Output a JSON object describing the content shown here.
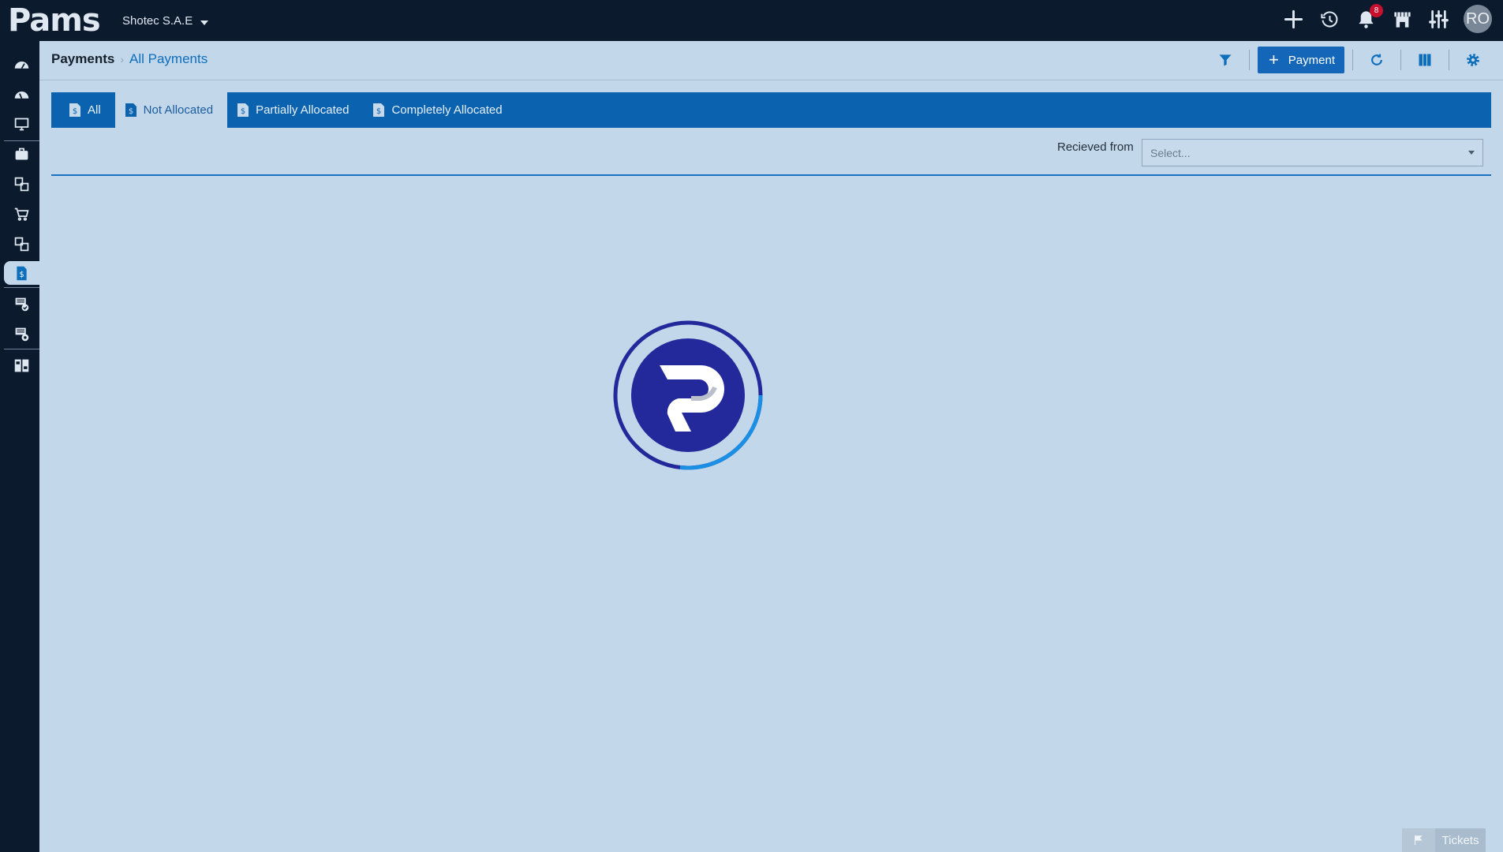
{
  "app": {
    "logo_text": "Pams",
    "company": "Shotec S.A.E"
  },
  "topbar": {
    "icons": [
      "plus-icon",
      "history-icon",
      "bell-icon",
      "store-icon",
      "sliders-icon"
    ],
    "notification_count": "8",
    "avatar_initials": "RO"
  },
  "sidebar": {
    "items": [
      "dashboard-icon",
      "dashboard-alt-icon",
      "monitor-icon",
      "briefcase-icon",
      "transfer-icon",
      "cart-icon",
      "transfer-alt-icon",
      "payments-icon",
      "invoice-check-icon",
      "invoice-settings-icon",
      "widgets-icon"
    ],
    "active_item": "payments-icon"
  },
  "breadcrumb": {
    "root": "Payments",
    "current": "All Payments"
  },
  "header": {
    "payment_button": "Payment"
  },
  "tabs": [
    {
      "label": "All"
    },
    {
      "label": "Not Allocated"
    },
    {
      "label": "Partially Allocated"
    },
    {
      "label": "Completely Allocated"
    }
  ],
  "active_tab": "Not Allocated",
  "filter": {
    "label": "Recieved from",
    "placeholder": "Select..."
  },
  "footer": {
    "tickets_label": "Tickets"
  },
  "colors": {
    "topbar": "#0b1a2d",
    "accent": "#0b63b0",
    "background": "#c3d7ea",
    "badge": "#c8102e"
  }
}
